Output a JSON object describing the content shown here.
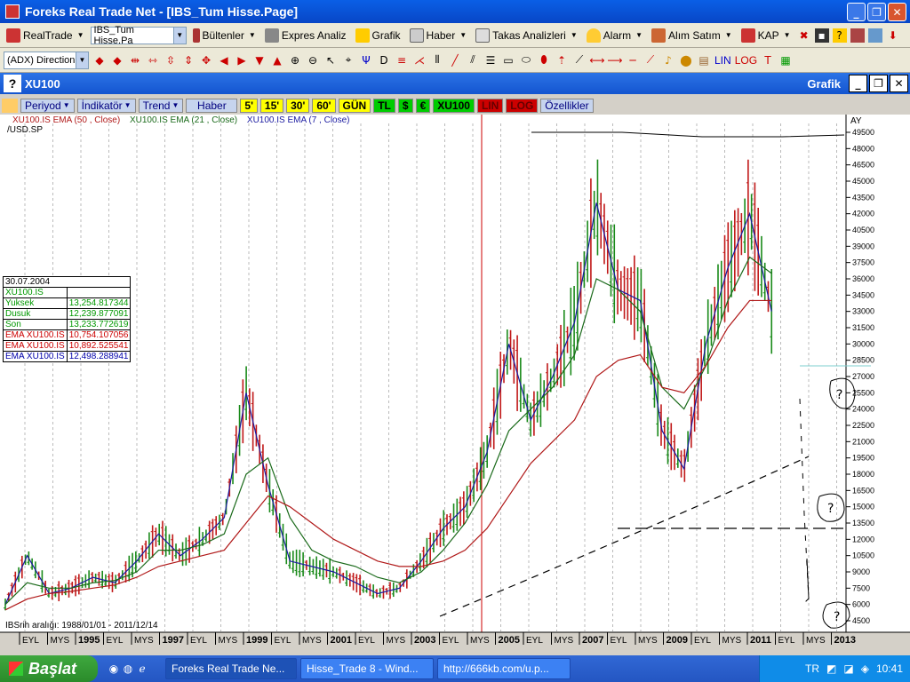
{
  "window": {
    "title": "Foreks Real Trade Net - [IBS_Tum Hisse.Page]"
  },
  "toolbar1": {
    "realtrade": "RealTrade",
    "page_select": "IBS_Tum Hisse.Pa",
    "bultenler": "Bültenler",
    "expres": "Expres Analiz",
    "grafik": "Grafik",
    "haber": "Haber",
    "takas": "Takas Analizleri",
    "alarm": "Alarm",
    "alim_satim": "Alım Satım",
    "kap": "KAP"
  },
  "toolbar2": {
    "indicator_select": "(ADX) Direction",
    "lin": "LIN",
    "log": "LOG"
  },
  "subwindow": {
    "symbol": "XU100",
    "right_label": "Grafik"
  },
  "chart_toolbar": {
    "periyod": "Periyod",
    "indikator": "İndikatör",
    "trend": "Trend",
    "haber": "Haber",
    "p5": "5'",
    "p15": "15'",
    "p30": "30'",
    "p60": "60'",
    "gun": "GÜN",
    "tl": "TL",
    "usd": "$",
    "eur": "€",
    "xu100": "XU100",
    "lin": "LIN",
    "log": "LOG",
    "ozellikler": "Özellikler"
  },
  "chart_legend": {
    "ema50": "XU100.IS EMA (50 , Close)",
    "ema21": "XU100.IS EMA (21 , Close)",
    "ema7": "XU100.IS EMA (7 , Close)",
    "usd": "/USD.SP",
    "period": "AY"
  },
  "info_table": {
    "date": "30.07.2004",
    "symbol": "XU100.IS",
    "rows": [
      {
        "label": "Yuksek",
        "value": "13,254.817344"
      },
      {
        "label": "Dusuk",
        "value": "12,239.877091"
      },
      {
        "label": "Son",
        "value": "13,233.772619"
      },
      {
        "label": "EMA XU100.IS",
        "value": "10,754.107056"
      },
      {
        "label": "EMA XU100.IS",
        "value": "10,892.525541"
      },
      {
        "label": "EMA XU100.IS",
        "value": "12,498.288941"
      }
    ]
  },
  "date_range": "IBSrih aralığı: 1988/01/01 - 2011/12/14",
  "chart_data": {
    "type": "line",
    "y_ticks": [
      "49500",
      "48000",
      "46500",
      "45000",
      "43500",
      "42000",
      "40500",
      "39000",
      "37500",
      "36000",
      "34500",
      "33000",
      "31500",
      "30000",
      "28500",
      "27000",
      "25500",
      "24000",
      "22500",
      "21000",
      "19500",
      "18000",
      "16500",
      "15000",
      "13500",
      "12000",
      "10500",
      "9000",
      "7500",
      "6000",
      "4500"
    ],
    "x_labels": [
      "EYL",
      "MYS",
      "1995",
      "EYL",
      "MYS",
      "1997",
      "EYL",
      "MYS",
      "1999",
      "EYL",
      "MYS",
      "2001",
      "EYL",
      "MYS",
      "2003",
      "EYL",
      "MYS",
      "2005",
      "EYL",
      "MYS",
      "2007",
      "EYL",
      "MYS",
      "2009",
      "EYL",
      "MYS",
      "2011",
      "EYL",
      "MYS",
      "2013"
    ],
    "ylim": [
      4500,
      49500
    ],
    "x": [
      1994.0,
      1994.5,
      1995.0,
      1995.5,
      1996.0,
      1996.5,
      1997.0,
      1997.5,
      1998.0,
      1998.5,
      1999.0,
      1999.5,
      2000.0,
      2000.5,
      2001.0,
      2001.5,
      2002.0,
      2002.5,
      2003.0,
      2003.5,
      2004.0,
      2004.5,
      2005.0,
      2005.5,
      2006.0,
      2006.5,
      2007.0,
      2007.5,
      2008.0,
      2008.5,
      2009.0,
      2009.5,
      2010.0,
      2010.5,
      2011.0,
      2011.5
    ],
    "series": [
      {
        "name": "XU100.IS EMA (7 , Close)",
        "color": "#1a1aa0",
        "values": [
          6000,
          10500,
          7000,
          7500,
          8500,
          8000,
          10000,
          12500,
          10500,
          12000,
          14000,
          25500,
          17000,
          10000,
          9500,
          9000,
          8000,
          7000,
          7500,
          10000,
          13000,
          15000,
          20000,
          30000,
          23000,
          27000,
          32000,
          43000,
          35000,
          34000,
          22000,
          18500,
          30000,
          37000,
          42000,
          33000
        ]
      },
      {
        "name": "XU100.IS EMA (21 , Close)",
        "color": "#1a6a1a",
        "values": [
          6000,
          8000,
          7500,
          7500,
          8000,
          8200,
          9000,
          11000,
          11000,
          11500,
          12500,
          18000,
          19500,
          14000,
          11000,
          10000,
          9500,
          8500,
          8000,
          9000,
          11000,
          13500,
          17000,
          22000,
          24000,
          26000,
          29000,
          36000,
          35000,
          33000,
          26000,
          24000,
          28000,
          34000,
          38000,
          36500
        ]
      },
      {
        "name": "XU100.IS EMA (50 , Close)",
        "color": "#b01818",
        "values": [
          5500,
          6500,
          7000,
          7200,
          7500,
          7800,
          8500,
          9500,
          10000,
          10500,
          11000,
          13500,
          16000,
          15000,
          13500,
          12000,
          11000,
          10000,
          9500,
          9500,
          10000,
          11000,
          13000,
          16000,
          19000,
          21000,
          23000,
          27000,
          28500,
          29000,
          26000,
          25500,
          28000,
          31500,
          34000,
          34000
        ]
      }
    ]
  },
  "taskbar": {
    "start": "Başlat",
    "tasks": [
      "Foreks Real Trade Ne...",
      "Hisse_Trade 8 - Wind...",
      "http://666kb.com/u.p..."
    ],
    "lang": "TR",
    "time": "10:41"
  }
}
